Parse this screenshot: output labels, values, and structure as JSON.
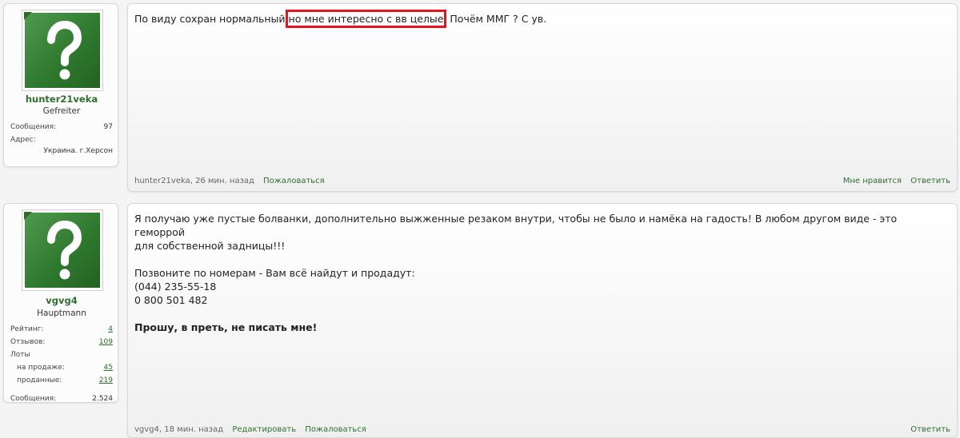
{
  "posts": [
    {
      "user": {
        "name": "hunter21veka",
        "rank": "Gefreiter",
        "stats": [
          {
            "label": "Сообщения:",
            "value": "97"
          },
          {
            "label": "Адрес:",
            "value": ""
          },
          {
            "label": "",
            "value": "Украина. г.Херсон"
          }
        ]
      },
      "message": {
        "part1": "По виду сохран нормальный ",
        "highlight": "но мне интересно с вв целые",
        "part2": ". Почём ММГ ? С ув."
      },
      "footer": {
        "author_time": "hunter21veka, 26 мин. назад",
        "report": "Пожаловаться",
        "like": "Мне нравится",
        "reply": "Ответить"
      }
    },
    {
      "user": {
        "name": "vgvg4",
        "rank": "Hauptmann",
        "stats": [
          {
            "label": "Рейтинг:",
            "value": "4"
          },
          {
            "label": "Отзывов:",
            "value": "109"
          },
          {
            "label": "Лоты",
            "value": ""
          },
          {
            "label": "на продаже:",
            "value": "45"
          },
          {
            "label": "проданные:",
            "value": "219"
          },
          {
            "label": "Сообщения:",
            "value": "2.524"
          }
        ]
      },
      "message": {
        "line1": "Я получаю уже пустые болванки, дополнительно выжженные резаком внутри, чтобы не было и намёка на гадость! В любом другом виде - это геморрой",
        "line2": "для собственной задницы!!!",
        "line3": "Позвоните по номерам - Вам всё найдут и продадут:",
        "line4": "(044) 235-55-18",
        "line5": "0 800 501 482",
        "line6": "Прошу, в преть, не писать мне!"
      },
      "footer": {
        "author_time": "vgvg4, 18 мин. назад",
        "edit": "Редактировать",
        "report": "Пожаловаться",
        "reply": "Ответить"
      }
    }
  ],
  "colors": {
    "accent_green": "#2f6e2f",
    "highlight_red": "#e4151f",
    "avatar_green": "#2f7a2f"
  },
  "icons": {
    "avatar": "question-mark-avatar-icon"
  }
}
